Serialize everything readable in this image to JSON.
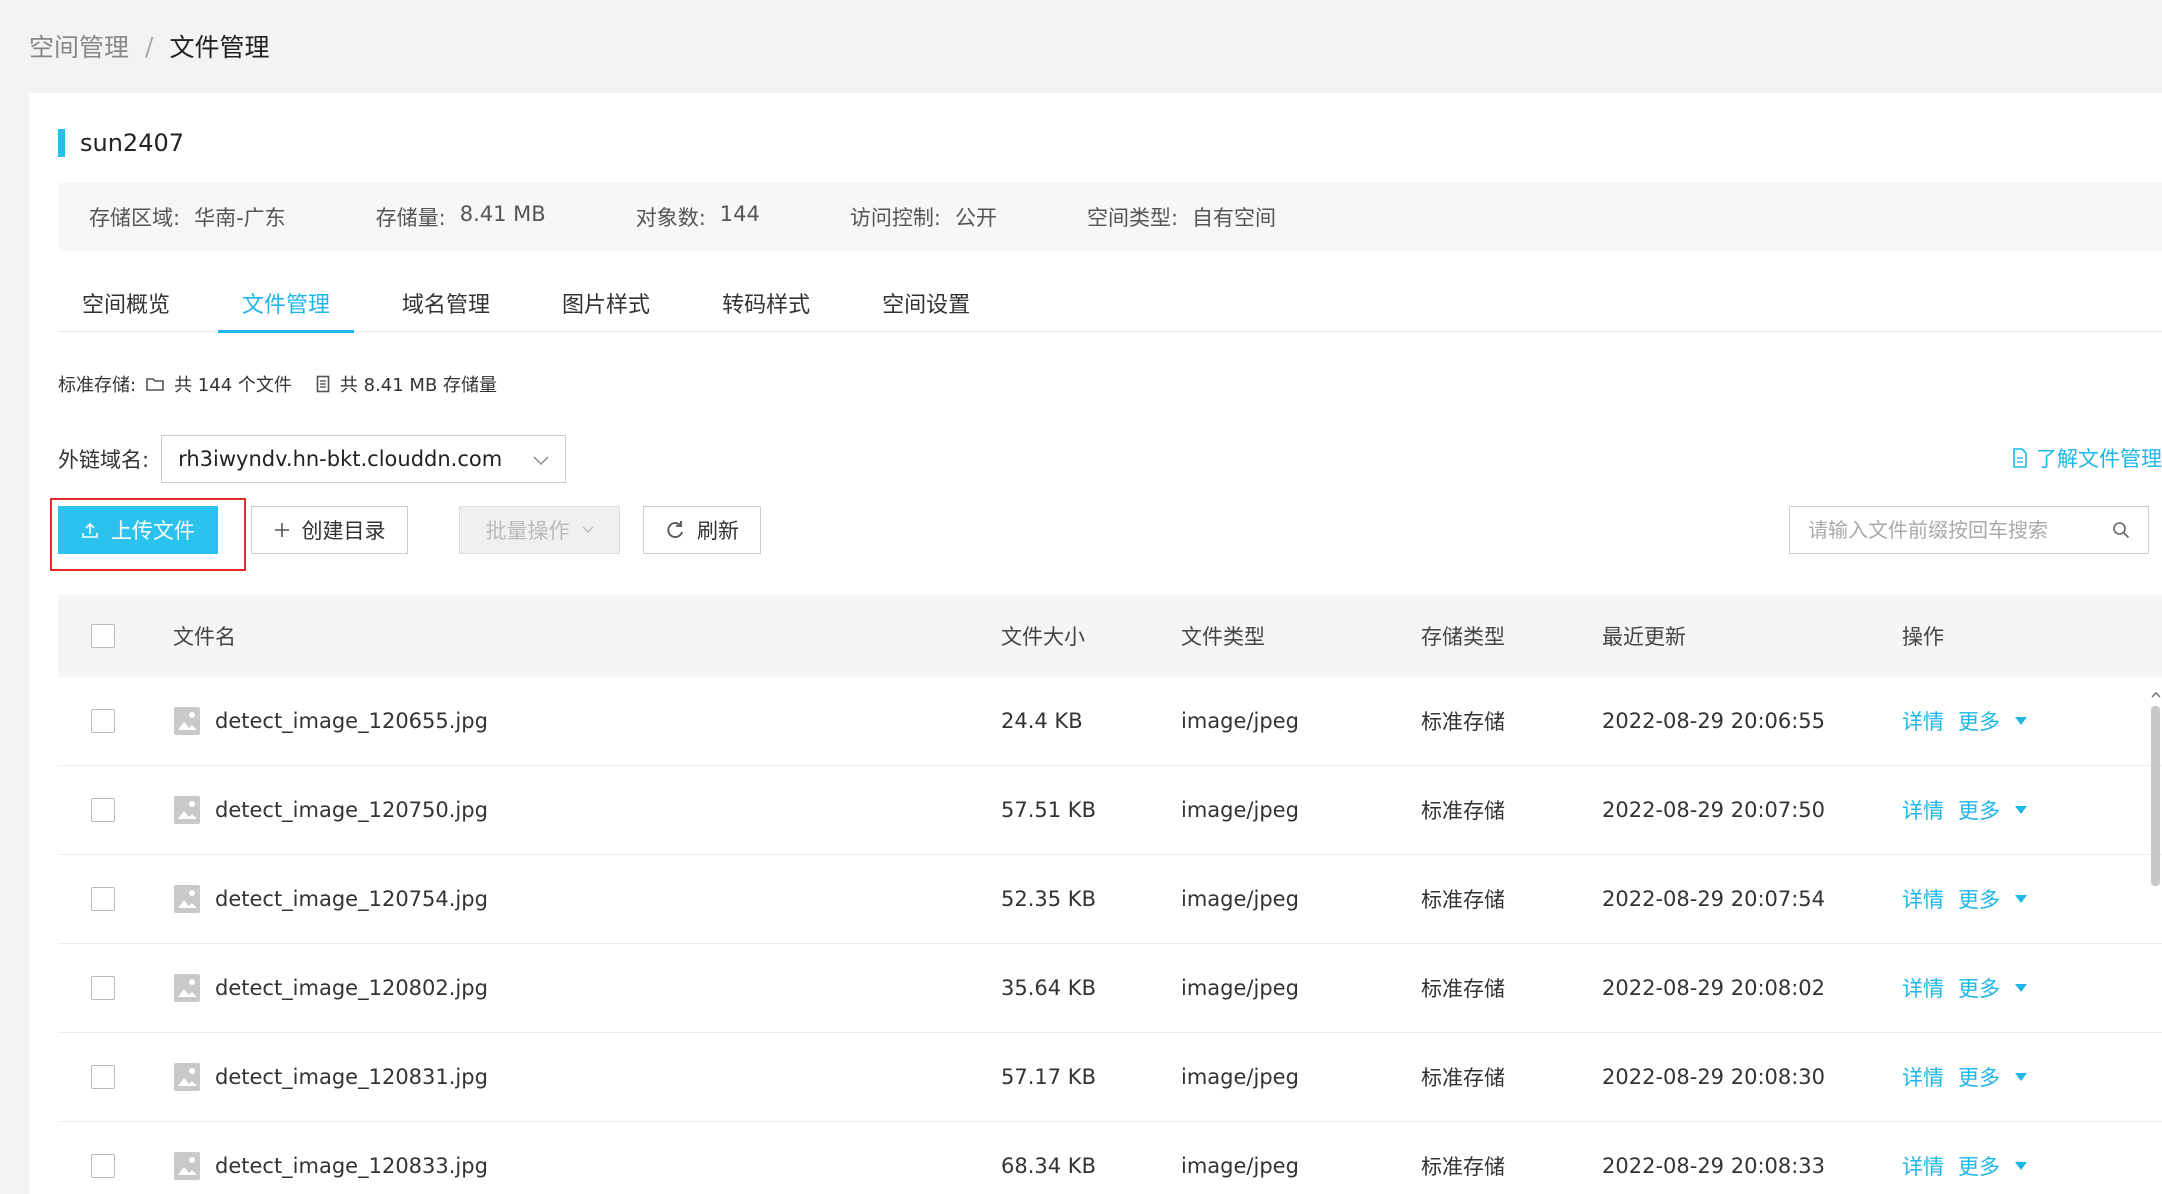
{
  "breadcrumb": {
    "parent": "空间管理",
    "separator": "/",
    "current": "文件管理"
  },
  "bucket": {
    "name": "sun2407"
  },
  "info": [
    {
      "label": "存储区域:",
      "value": "华南-广东"
    },
    {
      "label": "存储量:",
      "value": "8.41 MB"
    },
    {
      "label": "对象数:",
      "value": "144"
    },
    {
      "label": "访问控制:",
      "value": "公开"
    },
    {
      "label": "空间类型:",
      "value": "自有空间"
    }
  ],
  "tabs": [
    {
      "label": "空间概览",
      "active": false
    },
    {
      "label": "文件管理",
      "active": true
    },
    {
      "label": "域名管理",
      "active": false
    },
    {
      "label": "图片样式",
      "active": false
    },
    {
      "label": "转码样式",
      "active": false
    },
    {
      "label": "空间设置",
      "active": false
    }
  ],
  "summary": {
    "label": "标准存储:",
    "files": "共 144 个文件",
    "size": "共 8.41 MB 存储量",
    "folder_icon": "folder-icon",
    "storage_icon": "database-icon"
  },
  "domain": {
    "label": "外链域名:",
    "value": "rh3iwyndv.hn-bkt.clouddn.com"
  },
  "learn_link": "了解文件管理",
  "toolbar": {
    "upload": "上传文件",
    "mkdir": "创建目录",
    "batch": "批量操作",
    "refresh": "刷新",
    "search_placeholder": "请输入文件前缀按回车搜索"
  },
  "table": {
    "headers": {
      "name": "文件名",
      "size": "文件大小",
      "type": "文件类型",
      "storage": "存储类型",
      "updated": "最近更新",
      "ops": "操作"
    },
    "rows": [
      {
        "name": "detect_image_120655.jpg",
        "size": "24.4 KB",
        "type": "image/jpeg",
        "storage": "标准存储",
        "updated": "2022-08-29 20:06:55",
        "detail": "详情",
        "more": "更多"
      },
      {
        "name": "detect_image_120750.jpg",
        "size": "57.51 KB",
        "type": "image/jpeg",
        "storage": "标准存储",
        "updated": "2022-08-29 20:07:50",
        "detail": "详情",
        "more": "更多"
      },
      {
        "name": "detect_image_120754.jpg",
        "size": "52.35 KB",
        "type": "image/jpeg",
        "storage": "标准存储",
        "updated": "2022-08-29 20:07:54",
        "detail": "详情",
        "more": "更多"
      },
      {
        "name": "detect_image_120802.jpg",
        "size": "35.64 KB",
        "type": "image/jpeg",
        "storage": "标准存储",
        "updated": "2022-08-29 20:08:02",
        "detail": "详情",
        "more": "更多"
      },
      {
        "name": "detect_image_120831.jpg",
        "size": "57.17 KB",
        "type": "image/jpeg",
        "storage": "标准存储",
        "updated": "2022-08-29 20:08:30",
        "detail": "详情",
        "more": "更多"
      },
      {
        "name": "detect_image_120833.jpg",
        "size": "68.34 KB",
        "type": "image/jpeg",
        "storage": "标准存储",
        "updated": "2022-08-29 20:08:33",
        "detail": "详情",
        "more": "更多"
      }
    ]
  },
  "colors": {
    "accent": "#1fb6e8",
    "upload_bg": "#2bc3ee",
    "highlight": "#e02a2a",
    "title_bar": "#1fc3ea"
  }
}
